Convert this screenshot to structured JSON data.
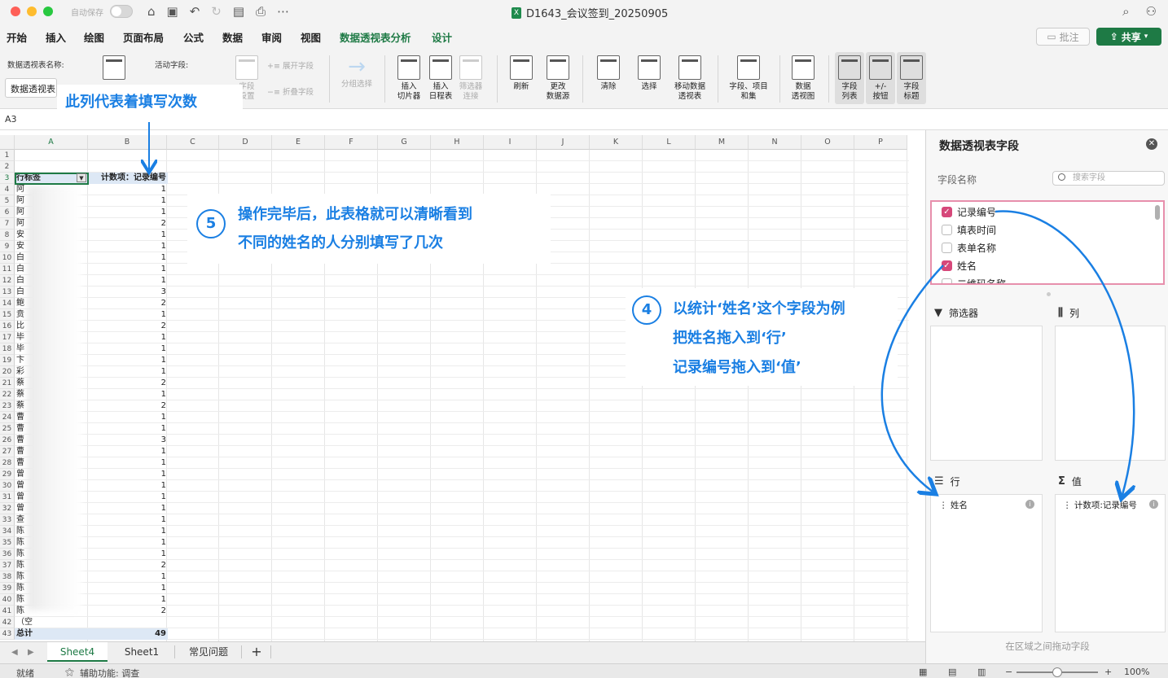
{
  "titlebar": {
    "autosave_label": "自动保存",
    "document_title": "D1643_会议签到_20250905",
    "file_badge": "X"
  },
  "menu_tabs": [
    "开始",
    "插入",
    "绘图",
    "页面布局",
    "公式",
    "数据",
    "审阅",
    "视图",
    "数据透视表分析",
    "设计"
  ],
  "menu_active": "数据透视表分析",
  "comment_label": "批注",
  "share_label": "共享",
  "ribbon": {
    "pivot_name_label": "数据透视表名称:",
    "pivot_name_value": "数据透视表",
    "active_field_label": "活动字段:",
    "field_settings": "字段\n设置",
    "expand_field": "展开字段",
    "collapse_field": "折叠字段",
    "group_select": "分组选择",
    "insert_slicer": "插入\n切片器",
    "insert_timeline": "插入\n日程表",
    "filter_connect": "筛选器\n连接",
    "refresh": "刷新",
    "change_source": "更改\n数据源",
    "clear": "清除",
    "select": "选择",
    "move_pivot": "移动数据\n透视表",
    "fields_items_sets": "字段、项目\n和集",
    "pivot_chart": "数据\n透视图",
    "field_list": "字段\n列表",
    "plus_minus": "+/-\n按钮",
    "field_headers": "字段\n标题"
  },
  "formula_bar": {
    "name_box": "A3"
  },
  "grid": {
    "columns": [
      "A",
      "B",
      "C",
      "D",
      "E",
      "F",
      "G",
      "H",
      "I",
      "J",
      "K",
      "L",
      "M",
      "N",
      "O",
      "P"
    ],
    "header_row": {
      "a": "行标签",
      "b": "计数项：记录编号"
    },
    "rows": [
      {
        "n": 4,
        "a": "阿",
        "b": "1"
      },
      {
        "n": 5,
        "a": "阿",
        "b": "1"
      },
      {
        "n": 6,
        "a": "阿",
        "b": "1"
      },
      {
        "n": 7,
        "a": "阿",
        "b": "2"
      },
      {
        "n": 8,
        "a": "安",
        "b": "1"
      },
      {
        "n": 9,
        "a": "安",
        "b": "1"
      },
      {
        "n": 10,
        "a": "白",
        "b": "1"
      },
      {
        "n": 11,
        "a": "白",
        "b": "1"
      },
      {
        "n": 12,
        "a": "白",
        "b": "1"
      },
      {
        "n": 13,
        "a": "白",
        "b": "3"
      },
      {
        "n": 14,
        "a": "鲍",
        "b": "2"
      },
      {
        "n": 15,
        "a": "贲",
        "b": "1"
      },
      {
        "n": 16,
        "a": "比",
        "b": "2"
      },
      {
        "n": 17,
        "a": "毕",
        "b": "1"
      },
      {
        "n": 18,
        "a": "毕",
        "b": "1"
      },
      {
        "n": 19,
        "a": "卞",
        "b": "1"
      },
      {
        "n": 20,
        "a": "彩",
        "b": "1"
      },
      {
        "n": 21,
        "a": "蔡",
        "b": "2"
      },
      {
        "n": 22,
        "a": "蔡",
        "b": "1"
      },
      {
        "n": 23,
        "a": "蔡",
        "b": "2"
      },
      {
        "n": 24,
        "a": "曹",
        "b": "1"
      },
      {
        "n": 25,
        "a": "曹",
        "b": "1"
      },
      {
        "n": 26,
        "a": "曹",
        "b": "3"
      },
      {
        "n": 27,
        "a": "曹",
        "b": "1"
      },
      {
        "n": 28,
        "a": "曹",
        "b": "1"
      },
      {
        "n": 29,
        "a": "曾",
        "b": "1"
      },
      {
        "n": 30,
        "a": "曾",
        "b": "1"
      },
      {
        "n": 31,
        "a": "曾",
        "b": "1"
      },
      {
        "n": 32,
        "a": "曾",
        "b": "1"
      },
      {
        "n": 33,
        "a": "查",
        "b": "1"
      },
      {
        "n": 34,
        "a": "陈",
        "b": "1"
      },
      {
        "n": 35,
        "a": "陈",
        "b": "1"
      },
      {
        "n": 36,
        "a": "陈",
        "b": "1"
      },
      {
        "n": 37,
        "a": "陈",
        "b": "2"
      },
      {
        "n": 38,
        "a": "陈",
        "b": "1"
      },
      {
        "n": 39,
        "a": "陈",
        "b": "1"
      },
      {
        "n": 40,
        "a": "陈",
        "b": "1"
      },
      {
        "n": 41,
        "a": "陈",
        "b": "2"
      },
      {
        "n": 42,
        "a": "（空",
        "b": ""
      }
    ],
    "total_row": {
      "n": 43,
      "a": "总计",
      "b": "49"
    }
  },
  "sheet_tabs": [
    "Sheet4",
    "Sheet1",
    "常见问题"
  ],
  "sheet_active": "Sheet4",
  "add_sheet": "+",
  "status": {
    "ready": "就绪",
    "accessibility": "辅助功能: 调查",
    "zoom_minus": "−",
    "zoom_plus": "+",
    "zoom": "100%"
  },
  "pivot_panel": {
    "title": "数据透视表字段",
    "field_name_label": "字段名称",
    "search_placeholder": "搜索字段",
    "fields": [
      {
        "label": "记录编号",
        "checked": true
      },
      {
        "label": "填表时间",
        "checked": false
      },
      {
        "label": "表单名称",
        "checked": false
      },
      {
        "label": "姓名",
        "checked": true
      },
      {
        "label": "二维码名称",
        "checked": false
      }
    ],
    "filters_label": "筛选器",
    "columns_label": "列",
    "rows_label": "行",
    "values_label": "值",
    "rows_items": [
      "姓名"
    ],
    "values_items": [
      "计数项:记录编号"
    ],
    "footer": "在区域之间拖动字段"
  },
  "annotations": {
    "col_note": "此列代表着填写次数",
    "step5_number": "5",
    "step5_line1": "操作完毕后，此表格就可以清晰看到",
    "step5_line2": "不同的姓名的人分别填写了几次",
    "step4_number": "4",
    "step4_line1": "以统计‘姓名’这个字段为例",
    "step4_line2": "把姓名拖入到‘行’",
    "step4_line3": "记录编号拖入到‘值’"
  },
  "colors": {
    "accent_green": "#1e7a45",
    "annotation_blue": "#1a7fe3",
    "check_pink": "#d6487a",
    "highlight_border": "#e78fac"
  }
}
